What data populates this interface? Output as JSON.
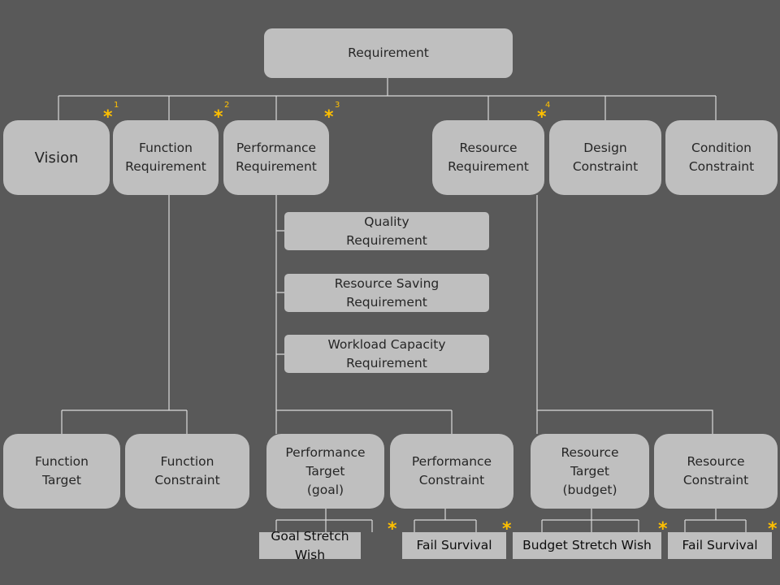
{
  "colors": {
    "background": "#595959",
    "box": "#bfbfbf",
    "line": "#d9d9d9",
    "asterisk": "#ffc000"
  },
  "root": "Requirement",
  "level1": [
    "Vision",
    "Function\nRequirement",
    "Performance\nRequirement",
    "Resource\nRequirement",
    "Design\nConstraint",
    "Condition\nConstraint"
  ],
  "performance_children": [
    "Quality\nRequirement",
    "Resource Saving\nRequirement",
    "Workload Capacity\nRequirement"
  ],
  "level2": [
    "Function\nTarget",
    "Function\nConstraint",
    "Performance\nTarget\n(goal)",
    "Performance\nConstraint",
    "Resource\nTarget\n(budget)",
    "Resource\nConstraint"
  ],
  "level3": [
    "Goal Stretch Wish",
    "Fail  Survival",
    "Budget Stretch Wish",
    "Fail   Survival"
  ],
  "asterisk": "*",
  "footnotes": [
    "1",
    "2",
    "3",
    "4"
  ]
}
